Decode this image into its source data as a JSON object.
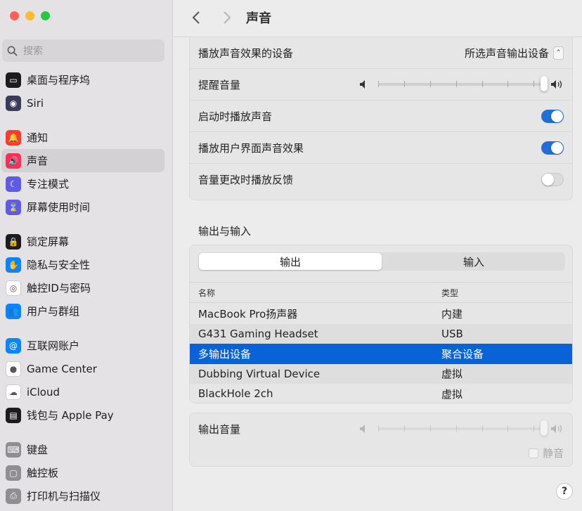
{
  "window": {
    "traffic_colors": [
      "#ff5f57",
      "#febc2e",
      "#28c840"
    ]
  },
  "search": {
    "placeholder": "搜索"
  },
  "sidebar": {
    "items": [
      {
        "label": "桌面与程序坞",
        "icon": "dock-icon",
        "color": "#1c1c1e"
      },
      {
        "label": "Siri",
        "icon": "siri-icon",
        "color": "#3a3a5a"
      },
      {
        "label": "通知",
        "icon": "bell-icon",
        "color": "#ff3b30"
      },
      {
        "label": "声音",
        "icon": "speaker-icon",
        "color": "#ff2d55"
      },
      {
        "label": "专注模式",
        "icon": "moon-icon",
        "color": "#5e5ce6"
      },
      {
        "label": "屏幕使用时间",
        "icon": "hourglass-icon",
        "color": "#5e5ce6"
      },
      {
        "label": "锁定屏幕",
        "icon": "lock-icon",
        "color": "#1c1c1e"
      },
      {
        "label": "隐私与安全性",
        "icon": "hand-icon",
        "color": "#0a84ff"
      },
      {
        "label": "触控ID与密码",
        "icon": "fingerprint-icon",
        "color": "#ffffff"
      },
      {
        "label": "用户与群组",
        "icon": "users-icon",
        "color": "#0a84ff"
      },
      {
        "label": "互联网账户",
        "icon": "at-icon",
        "color": "#0a84ff"
      },
      {
        "label": "Game Center",
        "icon": "gamecenter-icon",
        "color": "#ffffff"
      },
      {
        "label": "iCloud",
        "icon": "cloud-icon",
        "color": "#ffffff"
      },
      {
        "label": "钱包与 Apple Pay",
        "icon": "wallet-icon",
        "color": "#1c1c1e"
      },
      {
        "label": "键盘",
        "icon": "keyboard-icon",
        "color": "#8e8e93"
      },
      {
        "label": "触控板",
        "icon": "trackpad-icon",
        "color": "#8e8e93"
      },
      {
        "label": "打印机与扫描仪",
        "icon": "printer-icon",
        "color": "#8e8e93"
      }
    ],
    "active_index": 3
  },
  "header": {
    "title": "声音"
  },
  "effects": {
    "device_label": "播放声音效果的设备",
    "device_value": "所选声音输出设备",
    "alert_volume_label": "提醒音量",
    "alert_volume_level": 1.0,
    "startup_label": "启动时播放声音",
    "startup_on": true,
    "ui_effects_label": "播放用户界面声音效果",
    "ui_effects_on": true,
    "feedback_label": "音量更改时播放反馈",
    "feedback_on": false
  },
  "io": {
    "section_title": "输出与输入",
    "tabs": [
      "输出",
      "输入"
    ],
    "selected_tab": 0,
    "col_name": "名称",
    "col_type": "类型",
    "devices": [
      {
        "name": "MacBook Pro扬声器",
        "type": "内建"
      },
      {
        "name": "G431 Gaming Headset",
        "type": "USB"
      },
      {
        "name": "多输出设备",
        "type": "聚合设备"
      },
      {
        "name": "Dubbing Virtual Device",
        "type": "虚拟"
      },
      {
        "name": "BlackHole 2ch",
        "type": "虚拟"
      }
    ],
    "selected_device": 2
  },
  "output_volume": {
    "label": "输出音量",
    "level": 1.0,
    "mute_label": "静音",
    "mute_checked": false
  },
  "colors": {
    "accent": "#0963d7",
    "toggle_on": "#1e6fd9"
  },
  "help": {
    "symbol": "?"
  }
}
